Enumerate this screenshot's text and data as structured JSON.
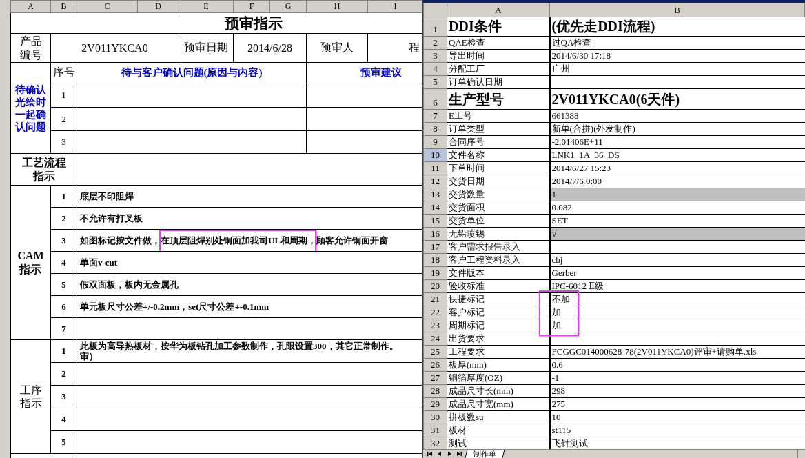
{
  "left_sheet": {
    "columns": [
      "A",
      "B",
      "C",
      "D",
      "E",
      "F",
      "G",
      "H",
      "I"
    ],
    "title": "预审指示",
    "product": {
      "label": "产品编号",
      "code": "2V011YKCA0",
      "date_label": "预审日期",
      "date": "2014/6/28",
      "reviewer_label": "预审人",
      "cut": "程"
    },
    "pending": {
      "label": "待确认光绘时一起确认问题",
      "headers": [
        "序号",
        "待与客户确认问题(原因与内容)",
        "预审建议"
      ],
      "rows": [
        "1",
        "2",
        "3"
      ]
    },
    "process": {
      "label": "工艺流程指示"
    },
    "cam": {
      "label": "CAM指示",
      "items": [
        {
          "no": "1",
          "segments": [
            {
              "text": "底层不印阻焊"
            }
          ]
        },
        {
          "no": "2",
          "segments": [
            {
              "text": "不允许有打叉板"
            }
          ]
        },
        {
          "no": "3",
          "segments": [
            {
              "text": "如图标记按文件做，"
            },
            {
              "text": "在顶层阻焊别处铜面加我司UL和周期，",
              "marked": true
            },
            {
              "text": "顾客允许铜面开窗"
            }
          ]
        },
        {
          "no": "4",
          "segments": [
            {
              "text": "单面v-cut"
            }
          ]
        },
        {
          "no": "5",
          "segments": [
            {
              "text": "假双面板，板内无金属孔"
            }
          ]
        },
        {
          "no": "6",
          "segments": [
            {
              "text": "单元板尺寸公差+/-0.2mm，set尺寸公差+-0.1mm"
            }
          ]
        },
        {
          "no": "7"
        }
      ]
    },
    "steps": {
      "label": "工序指示",
      "items": [
        {
          "no": "1",
          "lines": [
            "此板为高导热板材，按华为板钻孔加工参数制作，孔限设置300，其它正常制作。",
            "审）"
          ]
        },
        {
          "no": "2"
        },
        {
          "no": "3"
        },
        {
          "no": "4"
        },
        {
          "no": "5"
        }
      ]
    }
  },
  "right_sheet": {
    "columns": [
      "A",
      "B"
    ],
    "rows": [
      {
        "no": "1",
        "kind": "heading",
        "label": "DDI条件",
        "value": "(优先走DDI流程)",
        "shaded": false,
        "selected": false
      },
      {
        "no": "2",
        "kind": "field",
        "label": "QAE检查",
        "value": "过QA检查",
        "shaded": false,
        "selected": false
      },
      {
        "no": "3",
        "kind": "field",
        "label": "导出时间",
        "value": "2014/6/30 17:18",
        "shaded": false,
        "selected": false
      },
      {
        "no": "4",
        "kind": "field",
        "label": "分配工厂",
        "value": "广州",
        "shaded": false,
        "selected": false
      },
      {
        "no": "5",
        "kind": "field",
        "label": "订单确认日期",
        "shaded": false,
        "selected": false
      },
      {
        "no": "6",
        "kind": "heading",
        "label": "生产型号",
        "value": "2V011YKCA0(6天件)",
        "shaded": false,
        "selected": false
      },
      {
        "no": "7",
        "kind": "field",
        "label": "E工号",
        "value": "661388",
        "shaded": false,
        "selected": false
      },
      {
        "no": "8",
        "kind": "field",
        "label": "订单类型",
        "value": "新单(合拼)(外发制作)",
        "shaded": false,
        "selected": false
      },
      {
        "no": "9",
        "kind": "field",
        "label": "合同序号",
        "value": "-2.01406E+11",
        "shaded": false,
        "selected": false
      },
      {
        "no": "10",
        "kind": "field",
        "label": "文件名称",
        "value": "LNK1_1A_36_DS",
        "shaded": false,
        "selected": true
      },
      {
        "no": "11",
        "kind": "field",
        "label": "下单时间",
        "value": "2014/6/27 15:23",
        "shaded": false,
        "selected": false
      },
      {
        "no": "12",
        "kind": "field",
        "label": "交货日期",
        "value": "2014/7/6 0:00",
        "shaded": false,
        "selected": false
      },
      {
        "no": "13",
        "kind": "field",
        "label": "交货数量",
        "value": "1",
        "shaded": true,
        "selected": false
      },
      {
        "no": "14",
        "kind": "field",
        "label": "交货面积",
        "value": "0.082",
        "shaded": false,
        "selected": false
      },
      {
        "no": "15",
        "kind": "field",
        "label": "交货单位",
        "value": "SET",
        "shaded": false,
        "selected": false
      },
      {
        "no": "16",
        "kind": "field",
        "label": "无铅喷锡",
        "value": "√",
        "shaded": true,
        "selected": false
      },
      {
        "no": "17",
        "kind": "field",
        "label": "客户需求报告录入",
        "shaded": false,
        "selected": false
      },
      {
        "no": "18",
        "kind": "field",
        "label": "客户工程资料录入",
        "value": "chj",
        "shaded": false,
        "selected": false
      },
      {
        "no": "19",
        "kind": "field",
        "label": "文件版本",
        "value": "Gerber",
        "shaded": false,
        "selected": false
      },
      {
        "no": "20",
        "kind": "field",
        "label": "验收标准",
        "value": "IPC-6012 Ⅱ级",
        "shaded": false,
        "selected": false
      },
      {
        "no": "21",
        "kind": "field",
        "label": "快捷标记",
        "value": "不加",
        "shaded": false,
        "selected": false,
        "marked": true
      },
      {
        "no": "22",
        "kind": "field",
        "label": "客户标记",
        "value": "加",
        "shaded": false,
        "selected": false,
        "marked": true
      },
      {
        "no": "23",
        "kind": "field",
        "label": "周期标记",
        "value": "加",
        "shaded": false,
        "selected": false,
        "marked": true
      },
      {
        "no": "24",
        "kind": "field",
        "label": "出货要求",
        "shaded": false,
        "selected": false
      },
      {
        "no": "25",
        "kind": "field",
        "label": "工程要求",
        "value": "FCGGC014000628-78(2V011YKCA0)评审+请购单.xls",
        "shaded": false,
        "selected": false
      },
      {
        "no": "26",
        "kind": "field",
        "label": "板厚(mm)",
        "value": "0.6",
        "shaded": false,
        "selected": false
      },
      {
        "no": "27",
        "kind": "field",
        "label": "铜箔厚度(OZ)",
        "value": "-1",
        "shaded": false,
        "selected": false
      },
      {
        "no": "28",
        "kind": "field",
        "label": "成品尺寸长(mm)",
        "value": "298",
        "shaded": false,
        "selected": false
      },
      {
        "no": "29",
        "kind": "field",
        "label": "成品尺寸宽(mm)",
        "value": "275",
        "shaded": false,
        "selected": false
      },
      {
        "no": "30",
        "kind": "field",
        "label": "拼板数su",
        "value": "10",
        "shaded": false,
        "selected": false
      },
      {
        "no": "31",
        "kind": "field",
        "label": "板材",
        "value": "st115",
        "shaded": false,
        "selected": false
      },
      {
        "no": "32",
        "kind": "field",
        "label": "测试",
        "value": "飞针测试",
        "shaded": false,
        "selected": false
      }
    ]
  },
  "sheet_tabs": [
    {
      "label": "制作单",
      "selected": true
    }
  ]
}
